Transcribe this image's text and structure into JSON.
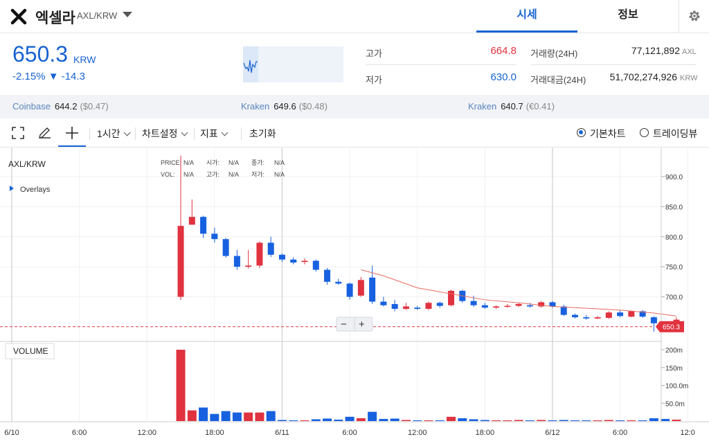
{
  "header": {
    "coin_name": "엑셀라",
    "pair": "AXL/KRW",
    "tabs": [
      "시세",
      "정보"
    ]
  },
  "price": {
    "current": "650.3",
    "currency": "KRW",
    "change_pct": "-2.15%",
    "change_abs": "▼ -14.3"
  },
  "stats": {
    "high_label": "고가",
    "high": "664.8",
    "low_label": "저가",
    "low": "630.0",
    "volume_label": "거래량(24H)",
    "volume": "77,121,892",
    "volume_unit": "AXL",
    "amount_label": "거래대금(24H)",
    "amount": "51,702,274,926",
    "amount_unit": "KRW"
  },
  "exchanges": [
    {
      "name": "Coinbase",
      "price": "644.2",
      "sub": "($0.47)"
    },
    {
      "name": "Kraken",
      "price": "649.6",
      "sub": "($0.48)"
    },
    {
      "name": "Kraken",
      "price": "640.7",
      "sub": "(€0.41)"
    }
  ],
  "toolbar": {
    "interval": "1시간",
    "chart_settings": "차트설정",
    "indicators": "지표",
    "reset": "초기화",
    "basic_chart": "기본차트",
    "trading_view": "트레이딩뷰"
  },
  "chart_data": {
    "type": "candlestick",
    "symbol": "AXL/KRW",
    "overlays_label": "Overlays",
    "legend": {
      "price_label": "PRICE:",
      "price_val": "N/A",
      "open_label": "시가:",
      "open_val": "N/A",
      "close_label": "종가:",
      "close_val": "N/A",
      "vol_label": "VOL:",
      "vol_val": "N/A",
      "high_label": "고가:",
      "high_val": "N/A",
      "low_label": "저가:",
      "low_val": "N/A"
    },
    "y_ticks": [
      900,
      850,
      800,
      750,
      700
    ],
    "y_tick_labels": [
      "900.0",
      "850.0",
      "800.0",
      "750.0",
      "700.0"
    ],
    "ylim": [
      642,
      921
    ],
    "last_price_label": "650.3",
    "volume_label": "VOLUME",
    "volume_ticks": [
      "200m",
      "150m",
      "100.0m",
      "50.0m"
    ],
    "volume_tick_values": [
      200,
      150,
      100,
      50
    ],
    "x_labels": [
      "6/10",
      "6:00",
      "12:00",
      "18:00",
      "6/11",
      "6:00",
      "12:00",
      "18:00",
      "6/12",
      "6:00",
      "12:0"
    ],
    "x_label_hours": [
      0,
      6,
      12,
      18,
      24,
      30,
      36,
      42,
      48,
      54,
      60
    ],
    "candles": [
      {
        "h": 15,
        "o": 700,
        "c": 818,
        "hi": 935,
        "lo": 695
      },
      {
        "h": 16,
        "o": 820,
        "c": 833,
        "hi": 862,
        "lo": 820
      },
      {
        "h": 17,
        "o": 833,
        "c": 805,
        "hi": 835,
        "lo": 798
      },
      {
        "h": 18,
        "o": 805,
        "c": 796,
        "hi": 815,
        "lo": 790
      },
      {
        "h": 19,
        "o": 796,
        "c": 768,
        "hi": 798,
        "lo": 765
      },
      {
        "h": 20,
        "o": 768,
        "c": 750,
        "hi": 778,
        "lo": 745
      },
      {
        "h": 21,
        "o": 750,
        "c": 752,
        "hi": 778,
        "lo": 747
      },
      {
        "h": 22,
        "o": 752,
        "c": 790,
        "hi": 792,
        "lo": 748
      },
      {
        "h": 23,
        "o": 790,
        "c": 770,
        "hi": 800,
        "lo": 766
      },
      {
        "h": 24,
        "o": 770,
        "c": 762,
        "hi": 772,
        "lo": 758
      },
      {
        "h": 25,
        "o": 762,
        "c": 757,
        "hi": 766,
        "lo": 754
      },
      {
        "h": 26,
        "o": 758,
        "c": 760,
        "hi": 764,
        "lo": 754
      },
      {
        "h": 27,
        "o": 760,
        "c": 745,
        "hi": 762,
        "lo": 742
      },
      {
        "h": 28,
        "o": 745,
        "c": 725,
        "hi": 748,
        "lo": 720
      },
      {
        "h": 29,
        "o": 725,
        "c": 722,
        "hi": 730,
        "lo": 720
      },
      {
        "h": 30,
        "o": 722,
        "c": 700,
        "hi": 724,
        "lo": 695
      },
      {
        "h": 31,
        "o": 702,
        "c": 728,
        "hi": 733,
        "lo": 700
      },
      {
        "h": 32,
        "o": 732,
        "c": 692,
        "hi": 752,
        "lo": 688
      },
      {
        "h": 33,
        "o": 692,
        "c": 686,
        "hi": 700,
        "lo": 684
      },
      {
        "h": 34,
        "o": 688,
        "c": 680,
        "hi": 695,
        "lo": 676
      },
      {
        "h": 35,
        "o": 680,
        "c": 684,
        "hi": 690,
        "lo": 678
      },
      {
        "h": 36,
        "o": 682,
        "c": 680,
        "hi": 685,
        "lo": 678
      },
      {
        "h": 37,
        "o": 680,
        "c": 690,
        "hi": 692,
        "lo": 678
      },
      {
        "h": 38,
        "o": 690,
        "c": 685,
        "hi": 692,
        "lo": 682
      },
      {
        "h": 39,
        "o": 686,
        "c": 710,
        "hi": 712,
        "lo": 684
      },
      {
        "h": 40,
        "o": 710,
        "c": 693,
        "hi": 712,
        "lo": 690
      },
      {
        "h": 41,
        "o": 693,
        "c": 686,
        "hi": 702,
        "lo": 683
      },
      {
        "h": 42,
        "o": 686,
        "c": 682,
        "hi": 690,
        "lo": 680
      },
      {
        "h": 43,
        "o": 682,
        "c": 684,
        "hi": 686,
        "lo": 680
      },
      {
        "h": 44,
        "o": 684,
        "c": 685,
        "hi": 688,
        "lo": 682
      },
      {
        "h": 45,
        "o": 685,
        "c": 688,
        "hi": 690,
        "lo": 683
      },
      {
        "h": 46,
        "o": 686,
        "c": 684,
        "hi": 690,
        "lo": 682
      },
      {
        "h": 47,
        "o": 684,
        "c": 691,
        "hi": 693,
        "lo": 682
      },
      {
        "h": 48,
        "o": 691,
        "c": 684,
        "hi": 693,
        "lo": 682
      },
      {
        "h": 49,
        "o": 684,
        "c": 670,
        "hi": 687,
        "lo": 668
      },
      {
        "h": 50,
        "o": 670,
        "c": 666,
        "hi": 672,
        "lo": 664
      },
      {
        "h": 51,
        "o": 666,
        "c": 664,
        "hi": 670,
        "lo": 662
      },
      {
        "h": 52,
        "o": 664,
        "c": 666,
        "hi": 668,
        "lo": 663
      },
      {
        "h": 53,
        "o": 665,
        "c": 674,
        "hi": 676,
        "lo": 663
      },
      {
        "h": 54,
        "o": 674,
        "c": 668,
        "hi": 678,
        "lo": 666
      },
      {
        "h": 55,
        "o": 667,
        "c": 676,
        "hi": 677,
        "lo": 666
      },
      {
        "h": 56,
        "o": 676,
        "c": 667,
        "hi": 678,
        "lo": 665
      },
      {
        "h": 57,
        "o": 666,
        "c": 656,
        "hi": 668,
        "lo": 642
      },
      {
        "h": 58,
        "o": 656,
        "c": 654,
        "hi": 658,
        "lo": 650
      },
      {
        "h": 59,
        "o": 651,
        "c": 662,
        "hi": 666,
        "lo": 648
      }
    ],
    "ma_line": [
      [
        31,
        745
      ],
      [
        33,
        735
      ],
      [
        36,
        715
      ],
      [
        39,
        705
      ],
      [
        42,
        695
      ],
      [
        45,
        690
      ],
      [
        48,
        684
      ],
      [
        51,
        681
      ],
      [
        54,
        678
      ],
      [
        57,
        673
      ],
      [
        59,
        668
      ]
    ],
    "volumes": [
      {
        "h": 15,
        "v": 200,
        "up": true
      },
      {
        "h": 16,
        "v": 30,
        "up": true
      },
      {
        "h": 17,
        "v": 38,
        "up": false
      },
      {
        "h": 18,
        "v": 20,
        "up": false
      },
      {
        "h": 19,
        "v": 28,
        "up": false
      },
      {
        "h": 20,
        "v": 24,
        "up": false
      },
      {
        "h": 21,
        "v": 24,
        "up": true
      },
      {
        "h": 22,
        "v": 24,
        "up": true
      },
      {
        "h": 23,
        "v": 28,
        "up": false
      },
      {
        "h": 24,
        "v": 3,
        "up": false
      },
      {
        "h": 25,
        "v": 2,
        "up": false
      },
      {
        "h": 26,
        "v": 2,
        "up": true
      },
      {
        "h": 27,
        "v": 5,
        "up": false
      },
      {
        "h": 28,
        "v": 7,
        "up": false
      },
      {
        "h": 29,
        "v": 4,
        "up": false
      },
      {
        "h": 30,
        "v": 12,
        "up": false
      },
      {
        "h": 31,
        "v": 8,
        "up": true
      },
      {
        "h": 32,
        "v": 26,
        "up": false
      },
      {
        "h": 33,
        "v": 6,
        "up": false
      },
      {
        "h": 34,
        "v": 7,
        "up": false
      },
      {
        "h": 35,
        "v": 3,
        "up": true
      },
      {
        "h": 36,
        "v": 2,
        "up": false
      },
      {
        "h": 37,
        "v": 2,
        "up": true
      },
      {
        "h": 38,
        "v": 2,
        "up": false
      },
      {
        "h": 39,
        "v": 12,
        "up": true
      },
      {
        "h": 40,
        "v": 8,
        "up": false
      },
      {
        "h": 41,
        "v": 5,
        "up": false
      },
      {
        "h": 42,
        "v": 3,
        "up": false
      },
      {
        "h": 43,
        "v": 2,
        "up": true
      },
      {
        "h": 44,
        "v": 2,
        "up": true
      },
      {
        "h": 45,
        "v": 3,
        "up": true
      },
      {
        "h": 46,
        "v": 2,
        "up": false
      },
      {
        "h": 47,
        "v": 3,
        "up": true
      },
      {
        "h": 48,
        "v": 2,
        "up": false
      },
      {
        "h": 49,
        "v": 3,
        "up": false
      },
      {
        "h": 50,
        "v": 2,
        "up": false
      },
      {
        "h": 51,
        "v": 2,
        "up": false
      },
      {
        "h": 52,
        "v": 2,
        "up": true
      },
      {
        "h": 53,
        "v": 3,
        "up": true
      },
      {
        "h": 54,
        "v": 2,
        "up": false
      },
      {
        "h": 55,
        "v": 2,
        "up": true
      },
      {
        "h": 56,
        "v": 2,
        "up": false
      },
      {
        "h": 57,
        "v": 8,
        "up": false
      },
      {
        "h": 58,
        "v": 6,
        "up": false
      },
      {
        "h": 59,
        "v": 4,
        "up": true
      }
    ],
    "zoom_minus": "−",
    "zoom_plus": "+"
  },
  "colors": {
    "up": "#e0323f",
    "down": "#1761e0",
    "accent": "#1763d2",
    "ma": "#e86a5e"
  }
}
